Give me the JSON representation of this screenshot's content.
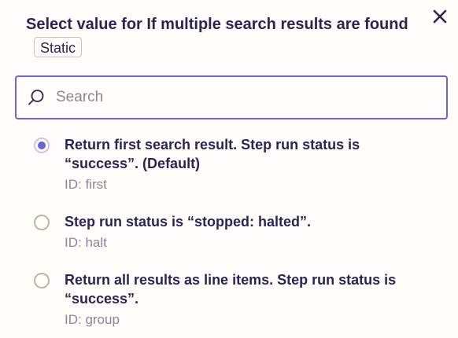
{
  "dialog": {
    "title": "Select value for If multiple search results are found",
    "badge": "Static",
    "close_icon": "close-icon"
  },
  "search": {
    "placeholder": "Search",
    "value": "",
    "icon": "search-icon"
  },
  "colors": {
    "accent": "#6d63d6",
    "text": "#2b2358",
    "muted": "#8a8597",
    "background": "#fffdf9"
  },
  "options": [
    {
      "label": "Return first search result. Step run status is “success”. (Default)",
      "id_text": "ID: first",
      "selected": true
    },
    {
      "label": "Step run status is “stopped: halted”.",
      "id_text": "ID: halt",
      "selected": false
    },
    {
      "label": "Return all results as line items. Step run status is “success”.",
      "id_text": "ID: group",
      "selected": false
    }
  ]
}
